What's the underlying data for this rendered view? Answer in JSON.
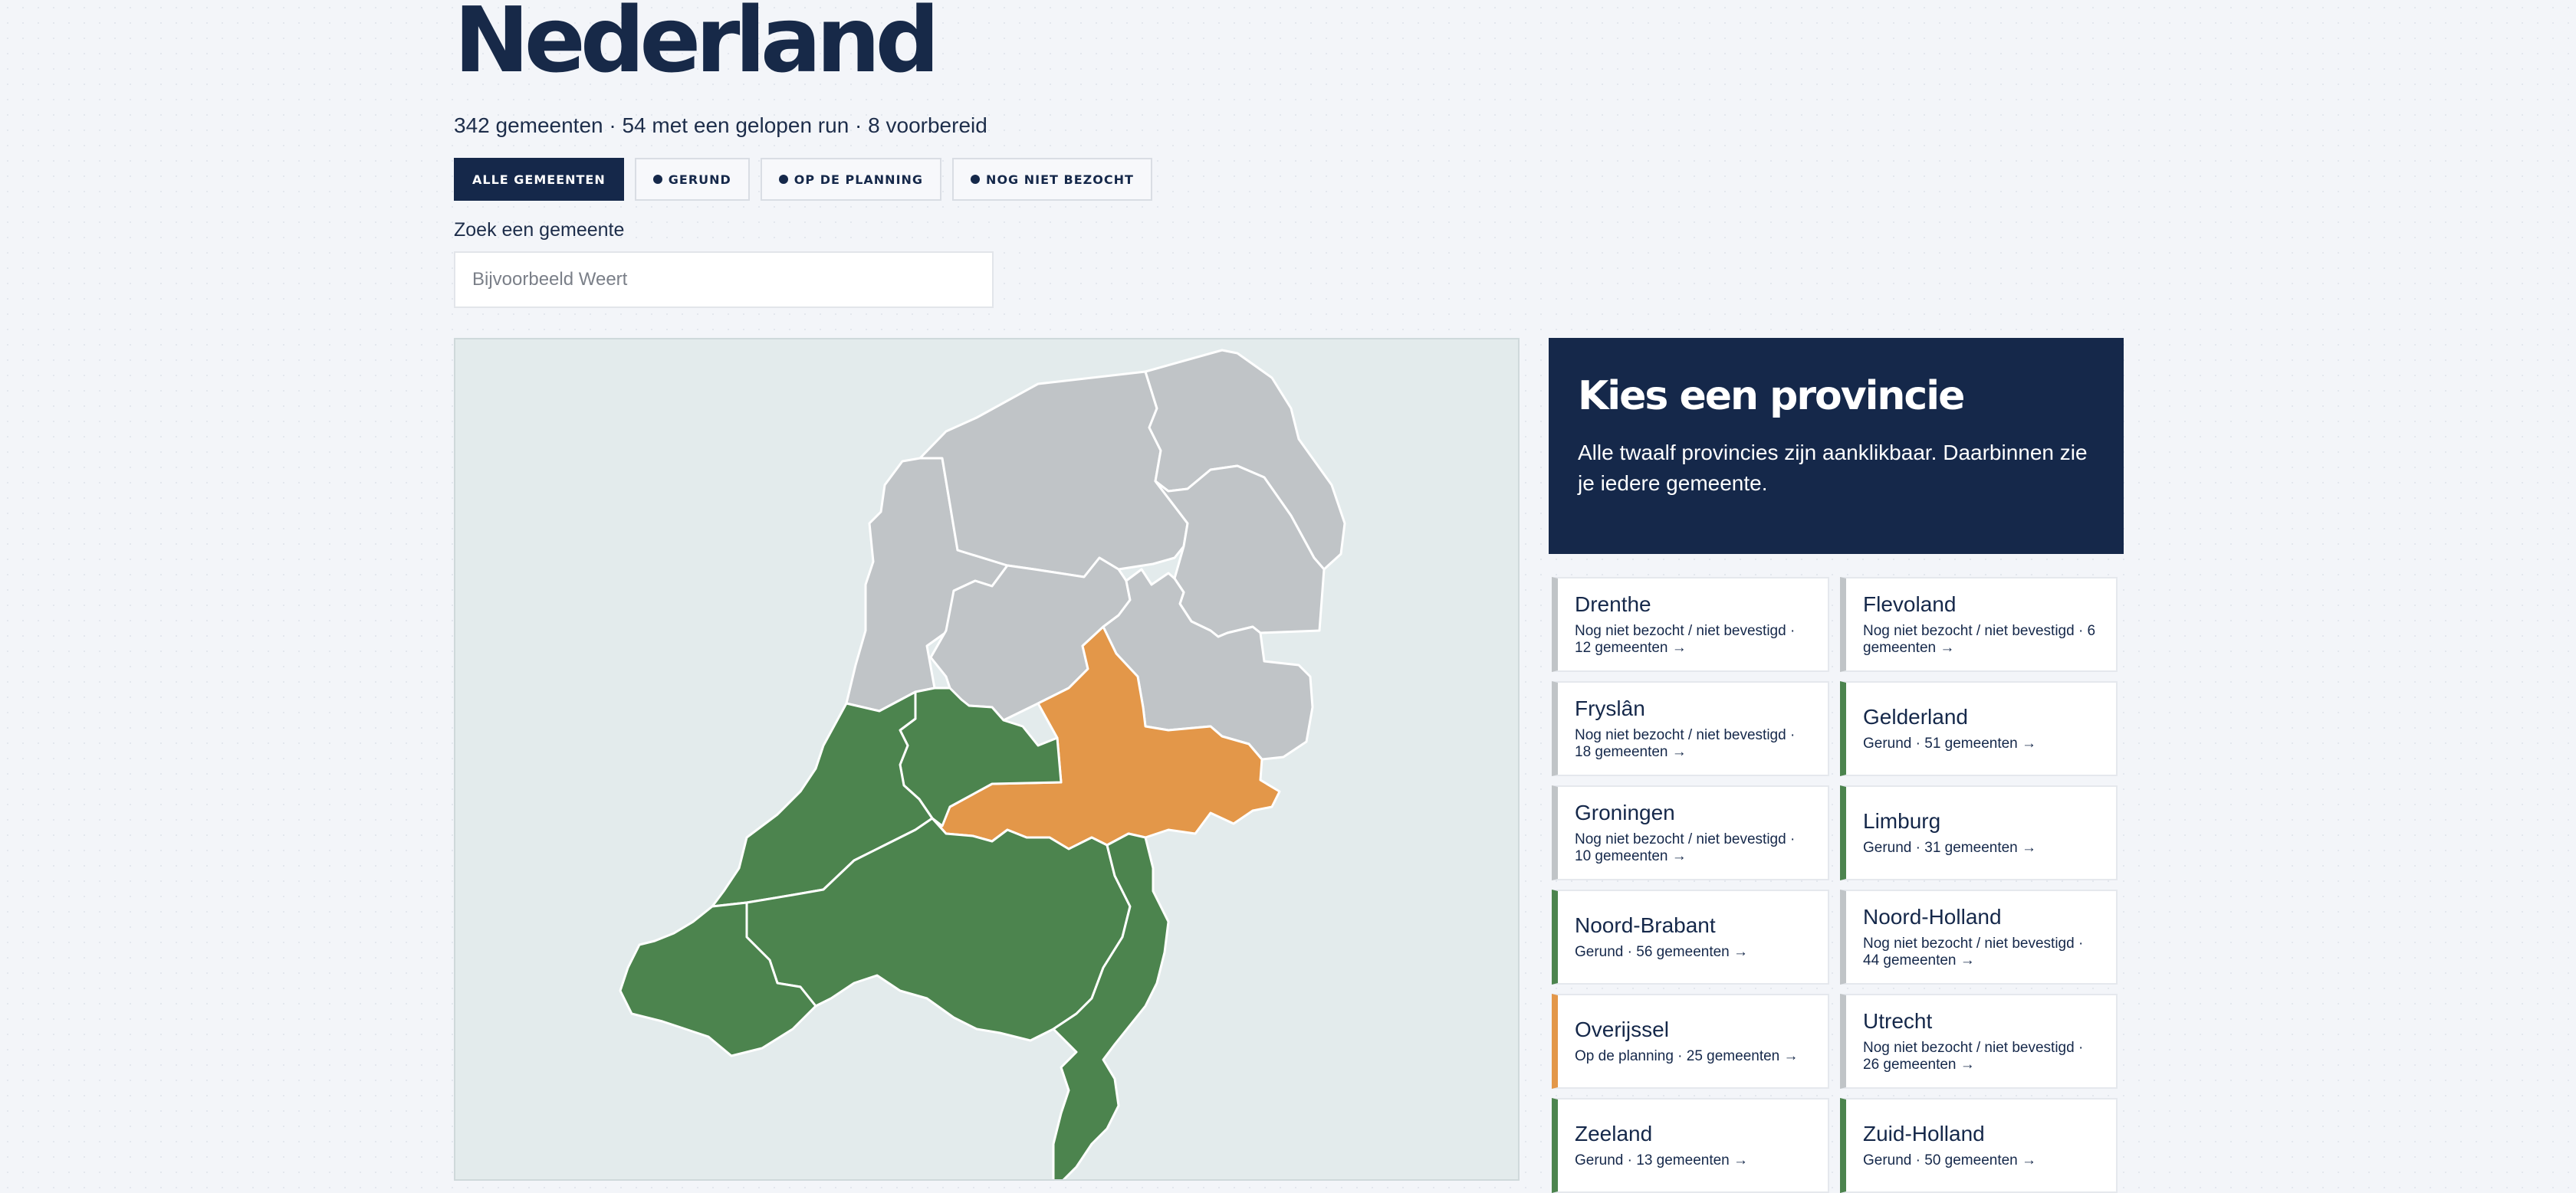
{
  "page": {
    "title": "Nederland",
    "stats": "342 gemeenten · 54 met een gelopen run · 8 voorbereid"
  },
  "filters": [
    {
      "label": "ALLE GEMEENTEN",
      "dot": false
    },
    {
      "label": "GERUND",
      "dot": true
    },
    {
      "label": "OP DE PLANNING",
      "dot": true
    },
    {
      "label": "NOG NIET BEZOCHT",
      "dot": true
    }
  ],
  "search": {
    "label": "Zoek een gemeente",
    "placeholder": "Bijvoorbeeld Weert"
  },
  "colors": {
    "gerund": "#4c844e",
    "planning": "#e39749",
    "unvisited": "#c0c4c7",
    "navy": "#15284a",
    "map_bg": "#e3ebec"
  },
  "map": {
    "regions": [
      {
        "name": "Noord-Holland",
        "status": "unvisited"
      },
      {
        "name": "Fryslân",
        "status": "unvisited"
      },
      {
        "name": "Groningen",
        "status": "unvisited"
      },
      {
        "name": "Drenthe",
        "status": "unvisited"
      },
      {
        "name": "Flevoland",
        "status": "unvisited"
      },
      {
        "name": "Utrecht",
        "status": "unvisited"
      },
      {
        "name": "Overijssel",
        "status": "planning"
      },
      {
        "name": "Gelderland",
        "status": "gerund"
      },
      {
        "name": "Zuid-Holland",
        "status": "gerund"
      },
      {
        "name": "Noord-Brabant",
        "status": "gerund"
      },
      {
        "name": "Limburg",
        "status": "gerund"
      }
    ]
  },
  "sidebar": {
    "title": "Kies een provincie",
    "description": "Alle twaalf provincies zijn aanklikbaar. Daarbinnen zie je iedere gemeente.",
    "provinces": [
      {
        "name": "Drenthe",
        "status": "unvisited",
        "detail": "Nog niet bezocht / niet bevestigd · 12 gemeenten →"
      },
      {
        "name": "Flevoland",
        "status": "unvisited",
        "detail": "Nog niet bezocht / niet bevestigd · 6 gemeenten →"
      },
      {
        "name": "Fryslân",
        "status": "unvisited",
        "detail": "Nog niet bezocht / niet bevestigd · 18 gemeenten →"
      },
      {
        "name": "Gelderland",
        "status": "gerund",
        "detail": "Gerund · 51 gemeenten →"
      },
      {
        "name": "Groningen",
        "status": "unvisited",
        "detail": "Nog niet bezocht / niet bevestigd · 10 gemeenten →"
      },
      {
        "name": "Limburg",
        "status": "gerund",
        "detail": "Gerund · 31 gemeenten →"
      },
      {
        "name": "Noord-Brabant",
        "status": "gerund",
        "detail": "Gerund · 56 gemeenten →"
      },
      {
        "name": "Noord-Holland",
        "status": "unvisited",
        "detail": "Nog niet bezocht / niet bevestigd · 44 gemeenten →"
      },
      {
        "name": "Overijssel",
        "status": "planning",
        "detail": "Op de planning · 25 gemeenten →"
      },
      {
        "name": "Utrecht",
        "status": "unvisited",
        "detail": "Nog niet bezocht / niet bevestigd · 26 gemeenten →"
      },
      {
        "name": "Zeeland",
        "status": "gerund",
        "detail": "Gerund · 13 gemeenten →"
      },
      {
        "name": "Zuid-Holland",
        "status": "gerund",
        "detail": "Gerund · 50 gemeenten →"
      }
    ]
  }
}
